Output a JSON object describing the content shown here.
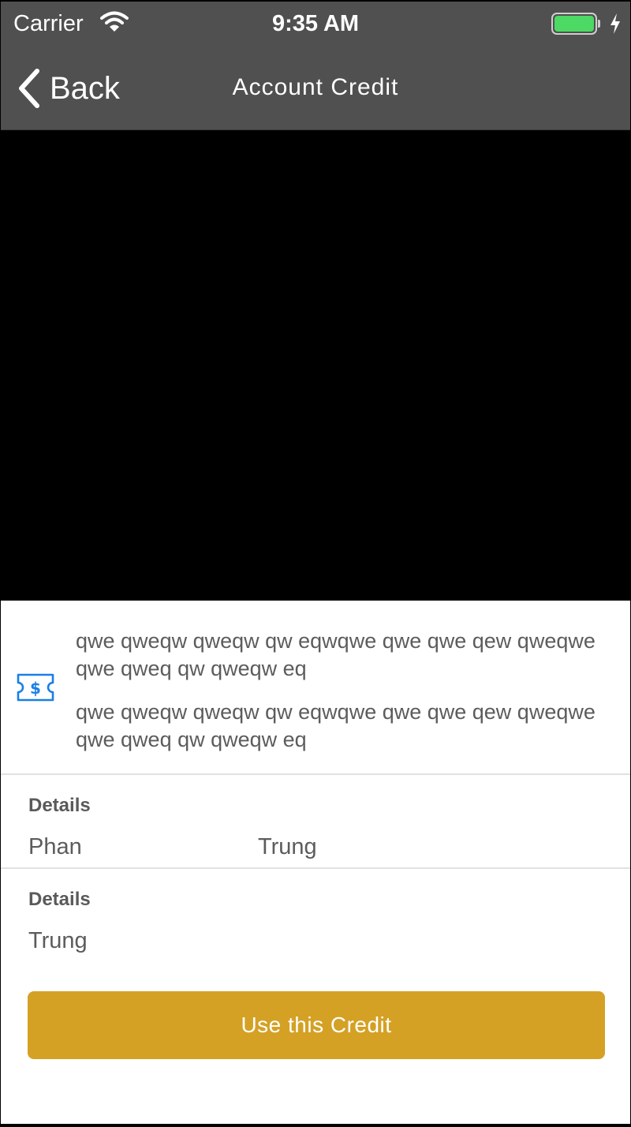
{
  "status_bar": {
    "carrier": "Carrier",
    "time": "9:35 AM",
    "wifi_icon": "wifi-icon",
    "battery_icon": "battery-icon",
    "charging_icon": "bolt-icon",
    "battery_color": "#4cd964"
  },
  "nav": {
    "back_label": "Back",
    "back_icon": "chevron-left-icon",
    "title": "Account Credit",
    "background": "#505050"
  },
  "credit": {
    "icon": "ticket-dollar-icon",
    "icon_color": "#1a7fe6",
    "text_1": "qwe qweqw qweqw qw eqwqwe qwe qwe qew qweqwe qwe qweq qw qweqw eq",
    "text_2": "qwe qweqw qweqw qw eqwqwe qwe qwe qew qweqwe qwe qweq qw qweqw eq"
  },
  "details_sections": [
    {
      "label": "Details",
      "values": [
        "Phan",
        "Trung"
      ]
    },
    {
      "label": "Details",
      "values": [
        "Trung"
      ]
    }
  ],
  "action": {
    "label": "Use this Credit",
    "color": "#d4a125"
  }
}
